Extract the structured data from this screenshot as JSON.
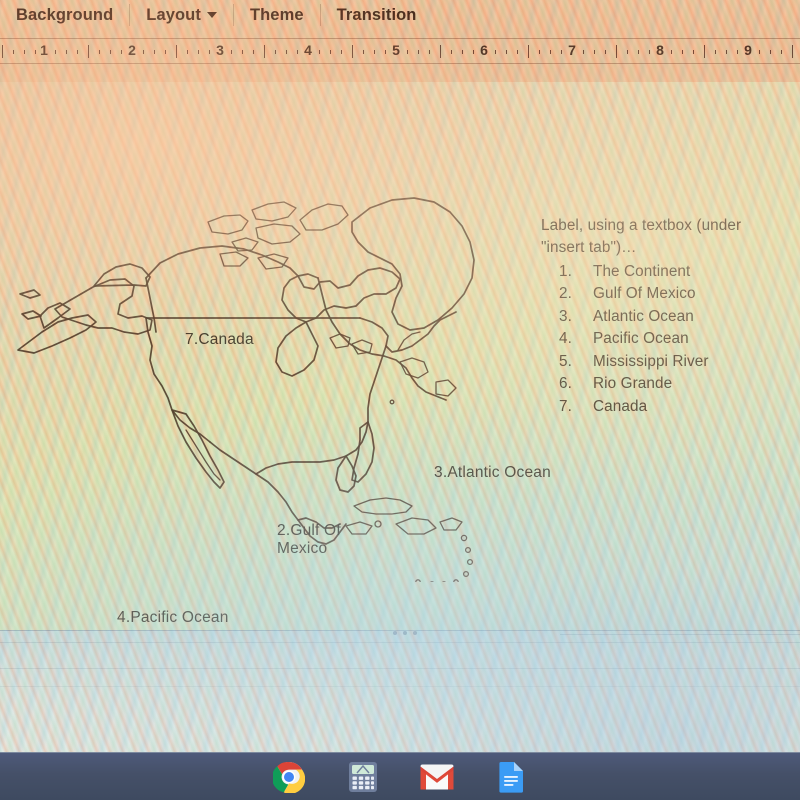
{
  "app": {
    "menubar": [
      {
        "label": "Background",
        "has_caret": false
      },
      {
        "label": "Layout",
        "has_caret": true
      },
      {
        "label": "Theme",
        "has_caret": false
      },
      {
        "label": "Transition",
        "has_caret": false
      }
    ],
    "ruler": {
      "numbers": [
        "1",
        "2",
        "3",
        "4",
        "5",
        "6",
        "7",
        "8",
        "9"
      ]
    }
  },
  "slide": {
    "map_title": "north-america-outline-map",
    "map_labels": [
      {
        "key": "canada",
        "text": "7.Canada"
      },
      {
        "key": "atlantic",
        "text": "3.Atlantic Ocean"
      },
      {
        "key": "gulf",
        "text": "2.Gulf Of\nMexico"
      },
      {
        "key": "pacific",
        "text": "4.Pacific Ocean"
      }
    ],
    "instructions": {
      "intro_line1": "Label, using a textbox (under",
      "intro_line2": "\"insert tab\")…",
      "items": [
        {
          "num": "1.",
          "label": "The Continent"
        },
        {
          "num": "2.",
          "label": "Gulf Of Mexico"
        },
        {
          "num": "3.",
          "label": "Atlantic Ocean"
        },
        {
          "num": "4.",
          "label": "Pacific Ocean"
        },
        {
          "num": "5.",
          "label": "Mississippi River"
        },
        {
          "num": "6.",
          "label": "Rio Grande"
        },
        {
          "num": "7.",
          "label": "Canada"
        }
      ]
    }
  },
  "shelf": {
    "icons": [
      {
        "name": "chrome-icon",
        "label": "Chrome"
      },
      {
        "name": "calculator-icon",
        "label": "Calculator"
      },
      {
        "name": "gmail-icon",
        "label": "Gmail"
      },
      {
        "name": "google-docs-icon",
        "label": "Docs"
      }
    ]
  },
  "colors": {
    "menu_text": "#4a2a1c",
    "slide_text": "#4c4436",
    "map_stroke": "#5b4433",
    "shelf_bg": "#455068"
  }
}
